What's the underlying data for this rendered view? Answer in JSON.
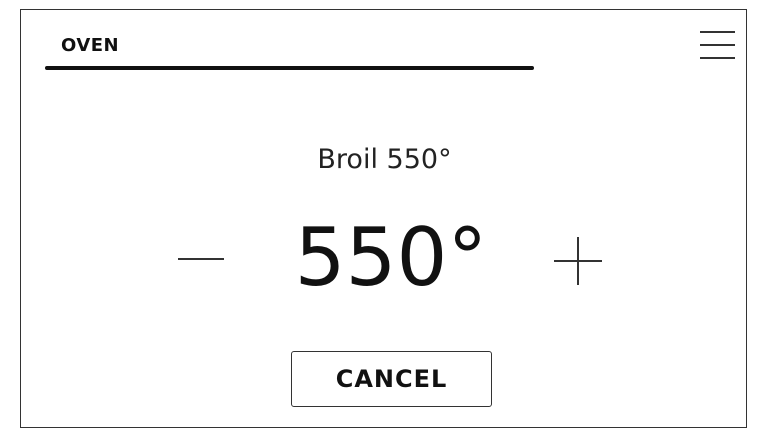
{
  "header": {
    "tab_title": "OVEN"
  },
  "menu": {
    "icon": "hamburger-menu-icon"
  },
  "cook_mode": {
    "label": "Broil 550°"
  },
  "temperature": {
    "value": "550°",
    "decrease_icon": "minus-icon",
    "increase_icon": "plus-icon"
  },
  "actions": {
    "cancel_label": "CANCEL"
  },
  "colors": {
    "background": "#ffffff",
    "text": "#111111",
    "border": "#333333"
  }
}
